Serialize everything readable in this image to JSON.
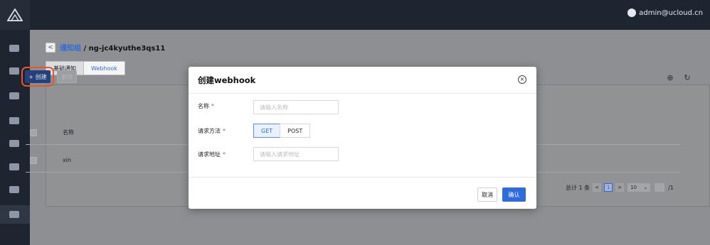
{
  "topbar": {
    "user": "admin@ucloud.cn"
  },
  "breadcrumb": {
    "back": "<",
    "parent": "通知组",
    "separator": " / ",
    "current": "ng-jc4kyuthe3qs11"
  },
  "tabs": [
    {
      "label": "基础通知"
    },
    {
      "label": "Webhook"
    }
  ],
  "toolbar": {
    "create": "+ 创建",
    "delete": "删除"
  },
  "table": {
    "header": "名称",
    "rows": [
      {
        "name": "xin"
      }
    ]
  },
  "pager": {
    "total": "总计 1 条",
    "prev": "<",
    "page": "1",
    "next": ">",
    "size": "10",
    "page_count": "/1"
  },
  "modal": {
    "title": "创建webhook",
    "fields": {
      "name_label": "名称",
      "name_placeholder": "请输入名称",
      "method_label": "请求方法",
      "methods": [
        "GET",
        "POST"
      ],
      "url_label": "请求地址",
      "url_placeholder": "请输入请求地址",
      "required_mark": "*"
    },
    "cancel": "取消",
    "confirm": "确认"
  },
  "colors": {
    "accent": "#2f6bdc",
    "highlight": "#e4572e",
    "topbar": "#1f2530"
  }
}
